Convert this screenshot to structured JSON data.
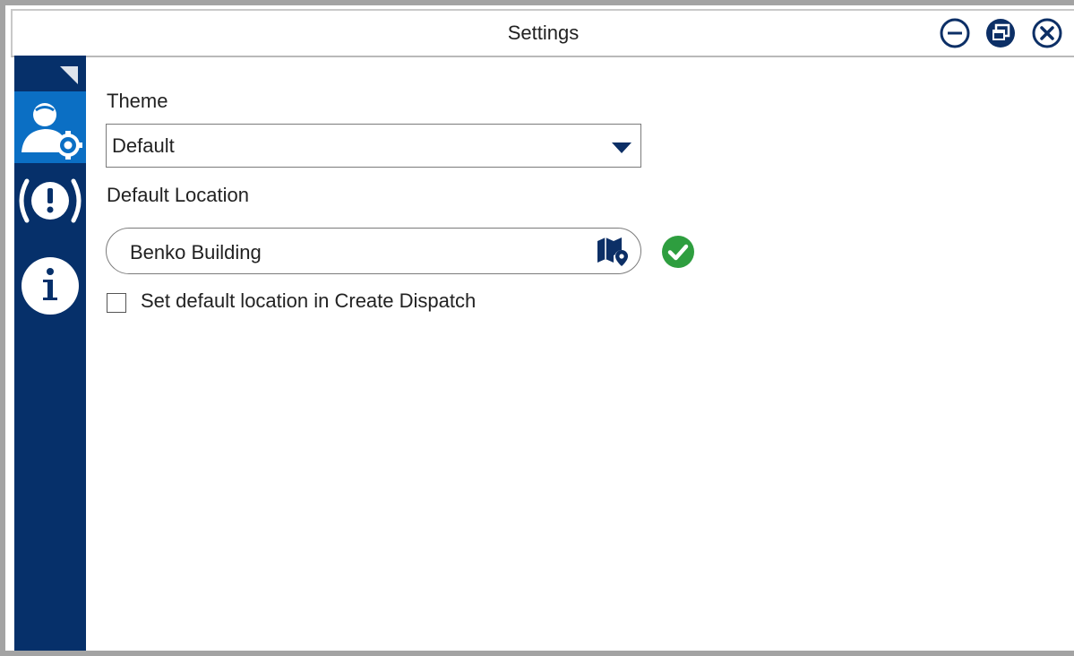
{
  "window": {
    "title": "Settings",
    "controls": [
      "minimize-icon",
      "restore-icon",
      "close-icon"
    ]
  },
  "sidebar": {
    "items": [
      {
        "icon": "user-settings-icon",
        "active": true
      },
      {
        "icon": "alert-icon",
        "active": false
      },
      {
        "icon": "info-icon",
        "active": false
      }
    ]
  },
  "settings": {
    "theme_label": "Theme",
    "theme_value": "Default",
    "location_label": "Default Location",
    "location_value": "Benko Building",
    "location_valid": true,
    "checkbox_label": "Set default location in Create Dispatch",
    "checkbox_checked": false
  },
  "colors": {
    "sidebar": "#06306a",
    "active_item": "#0b6fc4",
    "accent": "#0c2f66",
    "valid": "#2e9e3f"
  }
}
